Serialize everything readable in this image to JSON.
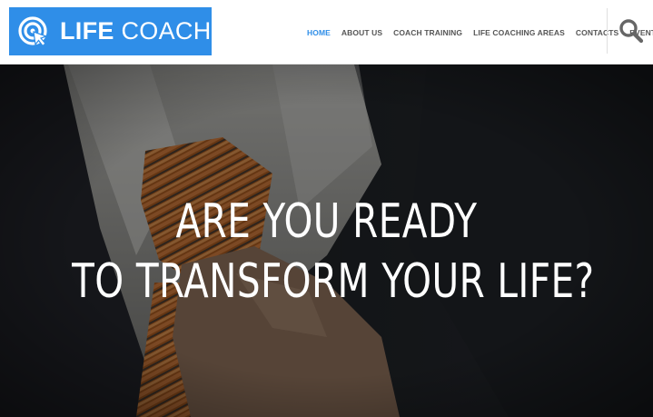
{
  "logo": {
    "text_bold": "LIFE",
    "text_light": " COACH",
    "icon": "target-cursor-icon",
    "bg_color": "#2f8ee8"
  },
  "nav": {
    "items": [
      {
        "label": "HOME",
        "active": true
      },
      {
        "label": "ABOUT US",
        "active": false
      },
      {
        "label": "COACH TRAINING",
        "active": false
      },
      {
        "label": "LIFE COACHING AREAS",
        "active": false
      },
      {
        "label": "CONTACTS",
        "active": false
      },
      {
        "label": "EVENTS",
        "active": false
      }
    ],
    "active_color": "#2f8ee8",
    "search_icon": "search-icon"
  },
  "hero": {
    "title_line1": "ARE YOU READY",
    "title_line2": "TO TRANSFORM YOUR LIFE?",
    "background": "man-in-suit-adjusting-orange-tie-photo"
  }
}
